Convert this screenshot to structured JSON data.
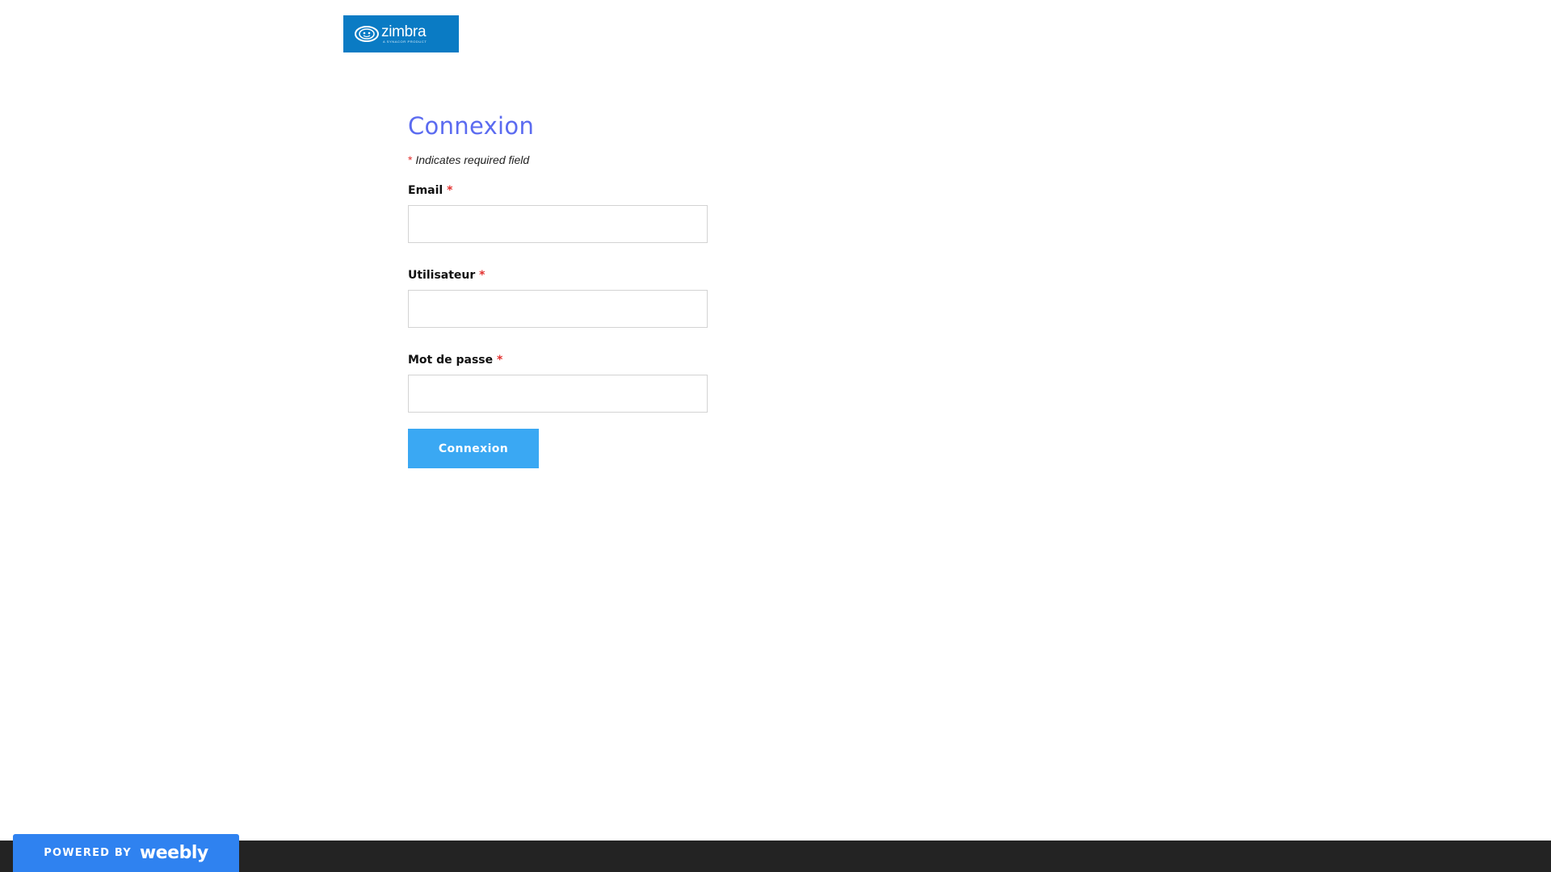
{
  "header": {
    "logo": {
      "word": "zimbra",
      "subtitle": "A SYNACOR PRODUCT",
      "icon": "zimbra-logo-icon",
      "background": "#0a7bc4"
    }
  },
  "form": {
    "title": "Connexion",
    "required_note": {
      "star": "*",
      "text": " Indicates required field"
    },
    "fields": [
      {
        "label": "Email",
        "star": "*",
        "value": "",
        "placeholder": ""
      },
      {
        "label": "Utilisateur",
        "star": "*",
        "value": "",
        "placeholder": ""
      },
      {
        "label": "Mot de passe",
        "star": "*",
        "value": "",
        "placeholder": ""
      }
    ],
    "submit_label": "Connexion"
  },
  "footer": {
    "powered_by": "POWERED BY",
    "brand": "weebly"
  },
  "colors": {
    "title": "#5b6bf0",
    "button": "#3aa8f3",
    "required": "#e2312f",
    "footer_bar": "#232323",
    "badge": "#2f82f0"
  }
}
